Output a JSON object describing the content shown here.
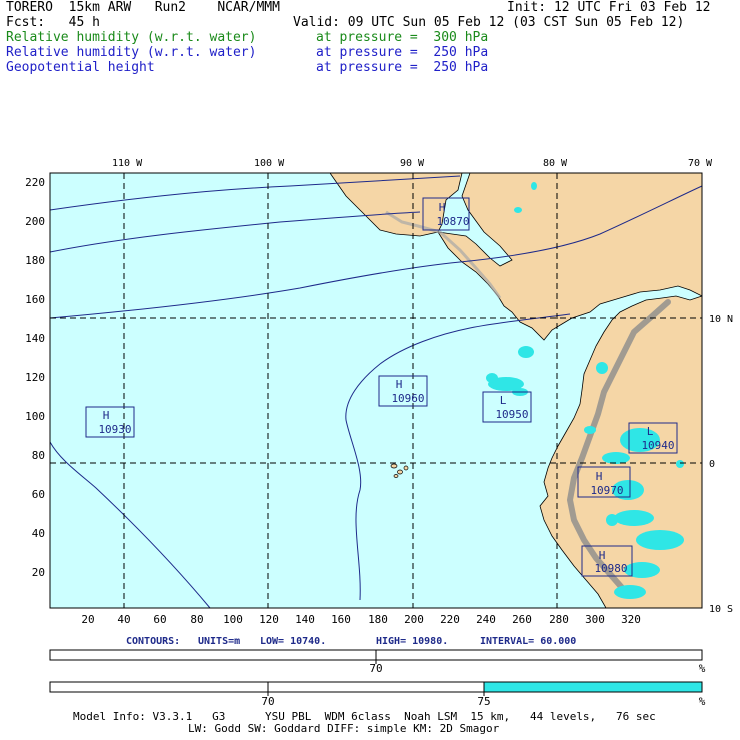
{
  "header": {
    "model": "TORERO  15km ARW   Run2    NCAR/MMM",
    "init": "Init: 12 UTC Fri 03 Feb 12",
    "fcst": "Fcst:   45 h",
    "valid": "Valid: 09 UTC Sun 05 Feb 12 (03 CST Sun 05 Feb 12)",
    "fields": [
      {
        "name": "Relative humidity (w.r.t. water)",
        "level": "at pressure =  300 hPa",
        "color": "#1a8a1a"
      },
      {
        "name": "Relative humidity (w.r.t. water)",
        "level": "at pressure =  250 hPa",
        "color": "#2020c8"
      },
      {
        "name": "Geopotential height",
        "level": "at pressure =  250 hPa",
        "color": "#2020c8"
      }
    ]
  },
  "map": {
    "lon_labels": [
      "110 W",
      "100 W",
      "90 W",
      "80 W",
      "70 W"
    ],
    "lat_labels": [
      "10 N",
      "0",
      "10 S"
    ],
    "y_ticks": [
      "220",
      "200",
      "180",
      "160",
      "140",
      "120",
      "100",
      "80",
      "60",
      "40",
      "20"
    ],
    "x_ticks": [
      "20",
      "40",
      "60",
      "80",
      "100",
      "120",
      "140",
      "160",
      "180",
      "200",
      "220",
      "240",
      "260",
      "280",
      "300",
      "320"
    ],
    "ocean_color": "#ccffff",
    "land_color": "#f5d6a6",
    "mountain_color": "#8c8c8c",
    "rh_color": "#2fe6e6",
    "contour_color": "#1e2a8a",
    "centers": [
      {
        "type": "H",
        "value": "10870"
      },
      {
        "type": "H",
        "value": "10930"
      },
      {
        "type": "H",
        "value": "10960"
      },
      {
        "type": "L",
        "value": "10950"
      },
      {
        "type": "L",
        "value": "10940"
      },
      {
        "type": "H",
        "value": "10970"
      },
      {
        "type": "H",
        "value": "10980"
      }
    ]
  },
  "contours_info": {
    "label": "CONTOURS:",
    "units": "UNITS=m",
    "low": "LOW=  10740.",
    "high": "HIGH=  10980.",
    "interval": "INTERVAL=   60.000"
  },
  "colorbars": [
    {
      "label": "70",
      "unit": "%"
    },
    {
      "labels": [
        "70",
        "75"
      ],
      "unit": "%",
      "fill_color": "#2fe6e6"
    }
  ],
  "footer": {
    "line1": "Model Info: V3.3.1   G3      YSU PBL  WDM 6class  Noah LSM  15 km,   44 levels,   76 sec",
    "line2": "LW: Godd SW: Goddard DIFF: simple KM: 2D Smagor"
  }
}
